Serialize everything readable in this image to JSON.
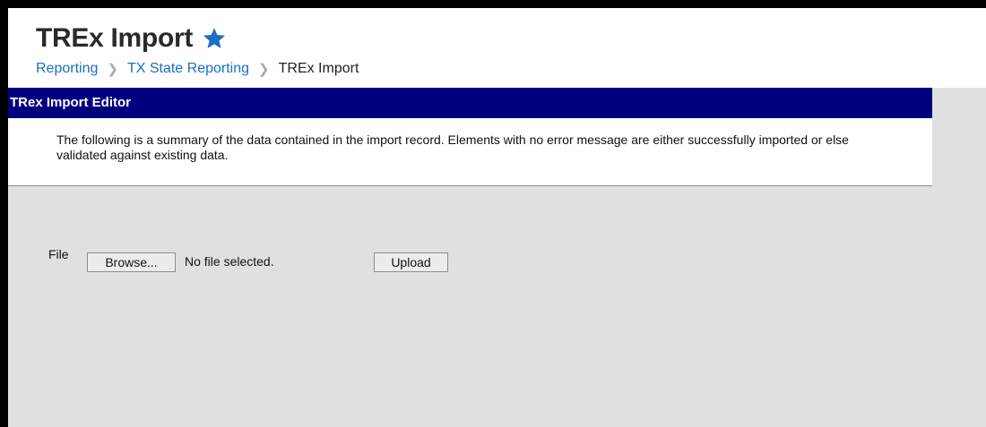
{
  "page": {
    "title": "TREx Import",
    "favorite_icon": "star-icon",
    "accent_color": "#1a6fc2"
  },
  "breadcrumb": {
    "items": [
      "Reporting",
      "TX State Reporting",
      "TREx Import"
    ],
    "separator_icon": "chevron-right-icon"
  },
  "editor": {
    "header": "TRex Import Editor",
    "header_color": "#00007f",
    "description": "The following is a summary of the data contained in the import record. Elements with no error message are either successfully imported or else validated against existing data."
  },
  "file_upload": {
    "label": "File",
    "browse_label": "Browse...",
    "status": "No file selected.",
    "upload_label": "Upload"
  }
}
